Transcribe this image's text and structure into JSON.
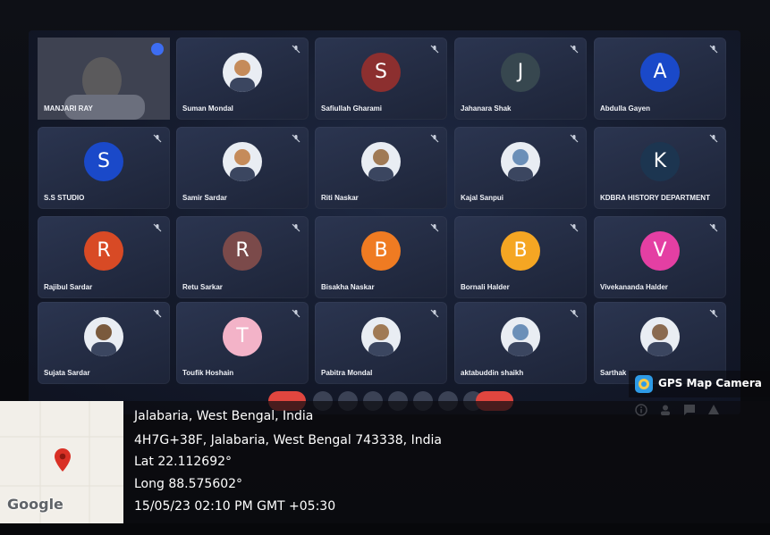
{
  "participants": [
    {
      "name": "MANJARI RAY",
      "type": "video",
      "active": true
    },
    {
      "name": "Suman Mondal",
      "type": "photo",
      "muted": true
    },
    {
      "name": "Safiullah Gharami",
      "type": "letter",
      "letter": "S",
      "color": "#8c2f2f",
      "muted": true
    },
    {
      "name": "Jahanara Shak",
      "type": "letter",
      "letter": "J",
      "color": "#37474f",
      "muted": true
    },
    {
      "name": "Abdulla Gayen",
      "type": "letter",
      "letter": "A",
      "color": "#1a49c9",
      "muted": true
    },
    {
      "name": "S.S STUDIO",
      "type": "letter",
      "letter": "S",
      "color": "#1a49c9",
      "muted": true
    },
    {
      "name": "Samir Sardar",
      "type": "photo",
      "muted": true
    },
    {
      "name": "Riti Naskar",
      "type": "photo",
      "muted": true
    },
    {
      "name": "Kajal Sanpui",
      "type": "photo",
      "muted": true
    },
    {
      "name": "KDBRA HISTORY DEPARTMENT",
      "type": "letter",
      "letter": "K",
      "color": "#1c3550",
      "muted": true
    },
    {
      "name": "Rajibul Sardar",
      "type": "letter",
      "letter": "R",
      "color": "#d84a25",
      "muted": true
    },
    {
      "name": "Retu Sarkar",
      "type": "letter",
      "letter": "R",
      "color": "#7b4a4a",
      "muted": true
    },
    {
      "name": "Bisakha Naskar",
      "type": "letter",
      "letter": "B",
      "color": "#ef7b22",
      "muted": true
    },
    {
      "name": "Bornali Halder",
      "type": "letter",
      "letter": "B",
      "color": "#f5a623",
      "muted": true
    },
    {
      "name": "Vivekananda Halder",
      "type": "letter",
      "letter": "V",
      "color": "#e43fa3",
      "muted": true
    },
    {
      "name": "Sujata Sardar",
      "type": "photo",
      "muted": true
    },
    {
      "name": "Toufik Hoshain",
      "type": "letter",
      "letter": "T",
      "color": "#f3b3c8",
      "muted": true
    },
    {
      "name": "Pabitra Mondal",
      "type": "photo",
      "muted": true
    },
    {
      "name": "aktabuddin shaikh",
      "type": "photo",
      "muted": true
    },
    {
      "name": "Sarthak",
      "type": "photo",
      "muted": true
    }
  ],
  "gps": {
    "badge": "GPS Map Camera",
    "place": "Jalabaria, West Bengal, India",
    "address": "4H7G+38F, Jalabaria, West Bengal 743338, India",
    "lat": "Lat 22.112692°",
    "long": "Long 88.575602°",
    "datetime": "15/05/23 02:10 PM GMT +05:30",
    "map_logo": "Google"
  },
  "colors": {
    "screen_bg": "#141a2b",
    "tile_bg": "#232b42",
    "accent": "#3d6df2",
    "leave": "#e0463f",
    "pin": "#d93025"
  }
}
